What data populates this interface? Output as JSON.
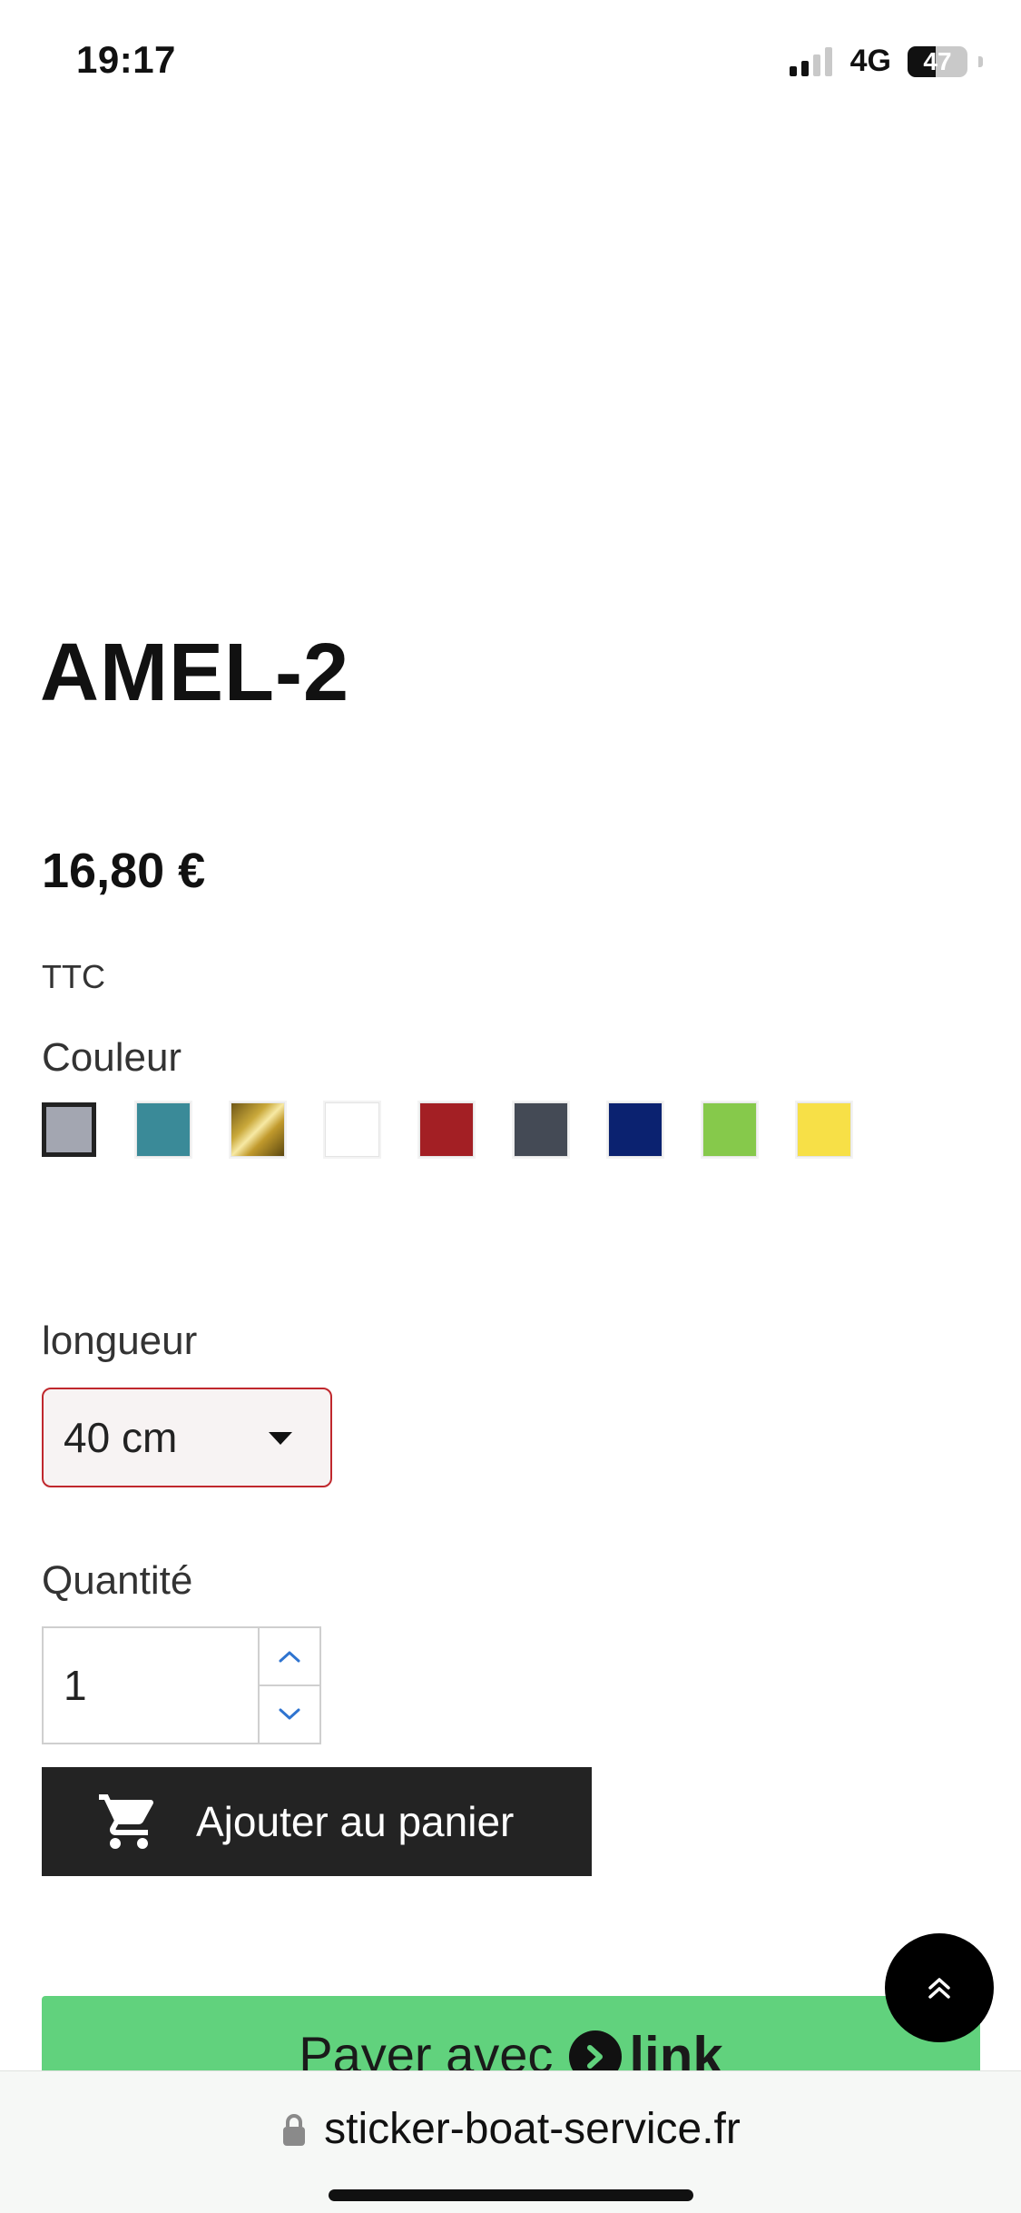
{
  "status_bar": {
    "time": "19:17",
    "network": "4G",
    "battery_percent": "47",
    "signal_bars_active": 2
  },
  "product": {
    "title": "AMEL-2",
    "price": "16,80 €",
    "tax_label": "TTC"
  },
  "color_option": {
    "label": "Couleur",
    "swatches": [
      {
        "color": "#a3a6b1",
        "selected": true
      },
      {
        "color": "#3a8a98"
      },
      {
        "color": "#c9a83a",
        "style": "metallic-gold"
      },
      {
        "color": "#ffffff"
      },
      {
        "color": "#a31f24"
      },
      {
        "color": "#444a55"
      },
      {
        "color": "#0b2270"
      },
      {
        "color": "#86c94b"
      },
      {
        "color": "#f7e047"
      }
    ]
  },
  "length_option": {
    "label": "longueur",
    "selected_value": "40 cm"
  },
  "quantity": {
    "label": "Quantité",
    "value": "1"
  },
  "buttons": {
    "add_to_cart": "Ajouter au panier",
    "pay_with_prefix": "Payer avec",
    "pay_with_brand": "link"
  },
  "browser": {
    "url": "sticker-boat-service.fr"
  },
  "colors": {
    "cart_button_bg": "#232323",
    "link_button_bg": "#61d27d",
    "select_border": "#c0282d",
    "stepper_arrow": "#2f74d0"
  }
}
